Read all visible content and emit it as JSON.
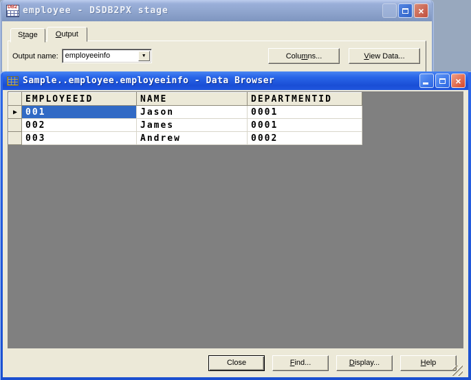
{
  "icons": {
    "row_marker": "▶",
    "combo_arrow": "▼",
    "close_glyph": "×",
    "db2_label": "DB2"
  },
  "stage_window": {
    "title": "employee - DSDB2PX stage",
    "tabs": [
      {
        "text": "Stage",
        "accel": 1
      },
      {
        "text": "Output",
        "accel": 0
      }
    ],
    "active_tab": "Output",
    "output_name_label": "Output name:",
    "output_name_value": "employeeinfo",
    "columns_button": {
      "text": "Columns...",
      "accel": 4
    },
    "view_data_button": {
      "text": "View Data...",
      "accel": 0
    }
  },
  "browser_window": {
    "title": "Sample..employee.employeeinfo - Data Browser",
    "grid": {
      "columns": [
        "EMPLOYEEID",
        "NAME",
        "DEPARTMENTID"
      ],
      "rows": [
        [
          "001",
          "Jason",
          "0001"
        ],
        [
          "002",
          "James",
          "0001"
        ],
        [
          "003",
          "Andrew",
          "0002"
        ]
      ],
      "selected_cell": {
        "row": 0,
        "column": "EMPLOYEEID"
      }
    },
    "buttons": {
      "close": {
        "text": "Close",
        "accel": -1
      },
      "find": {
        "text": "Find...",
        "accel": 0
      },
      "display": {
        "text": "Display...",
        "accel": 0
      },
      "help": {
        "text": "Help",
        "accel": 0
      }
    }
  },
  "colors": {
    "desktop_bg": "#98A8BE",
    "dialog_bg": "#ECE9D8",
    "client_bg": "#808080",
    "selection_blue": "#316AC5",
    "active_titlebar_blue": "#1D51DD",
    "inactive_titlebar_blue": "#8FA5CE"
  }
}
